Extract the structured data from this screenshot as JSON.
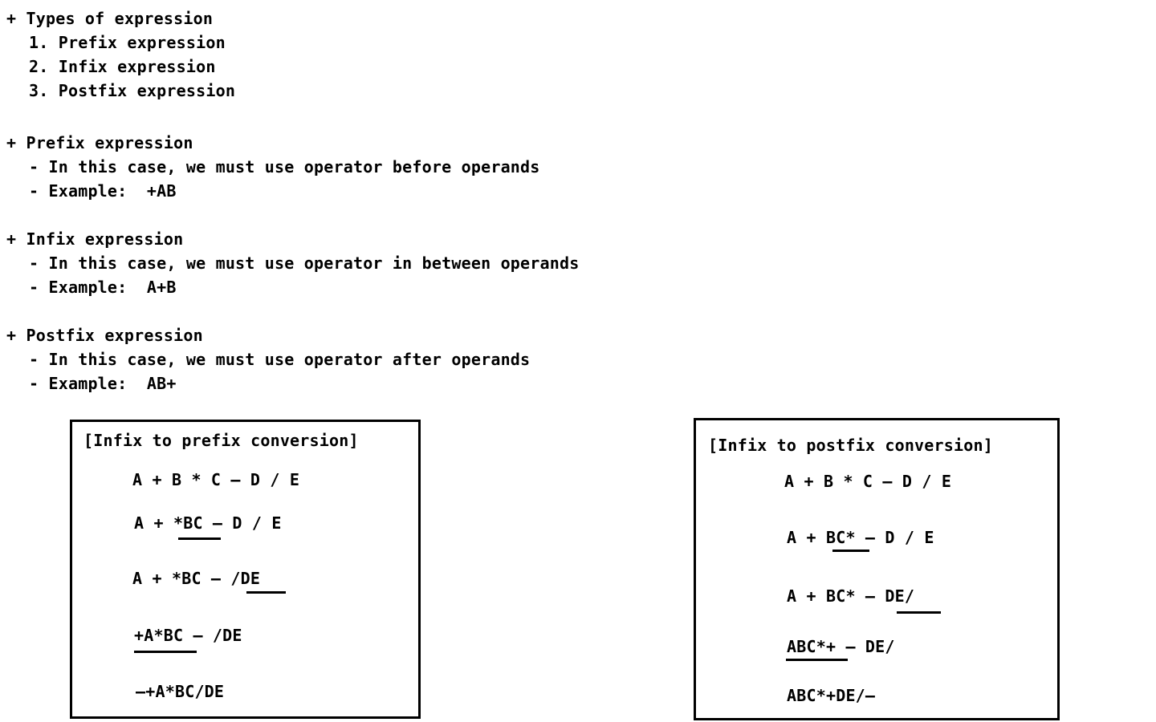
{
  "notes": {
    "types": {
      "heading": "+ Types of expression",
      "items": [
        "1. Prefix expression",
        "2. Infix expression",
        "3. Postfix expression"
      ]
    },
    "prefix": {
      "heading": "+ Prefix expression",
      "rule": "- In this case, we must use operator before operands",
      "example": "- Example:  +AB"
    },
    "infix": {
      "heading": "+ Infix expression",
      "rule": "- In this case, we must use operator in between operands",
      "example": "- Example:  A+B"
    },
    "postfix": {
      "heading": "+ Postfix expression",
      "rule": "- In this case, we must use operator after operands",
      "example": "- Example:  AB+"
    }
  },
  "prefix_box": {
    "title": "[Infix to prefix conversion]",
    "steps": [
      "A + B * C – D / E",
      "A + *BC – D / E",
      "A + *BC – /DE",
      "+A*BC – /DE",
      "–+A*BC/DE"
    ],
    "underlined": [
      "*BC",
      "/DE",
      "+A*BC"
    ]
  },
  "postfix_box": {
    "title": "[Infix to postfix conversion]",
    "steps": [
      "A + B * C – D / E",
      "A + BC* – D / E",
      "A + BC* – DE/",
      "ABC*+ – DE/",
      "ABC*+DE/–"
    ],
    "underlined": [
      "BC*",
      "DE/",
      "ABC*+"
    ]
  }
}
